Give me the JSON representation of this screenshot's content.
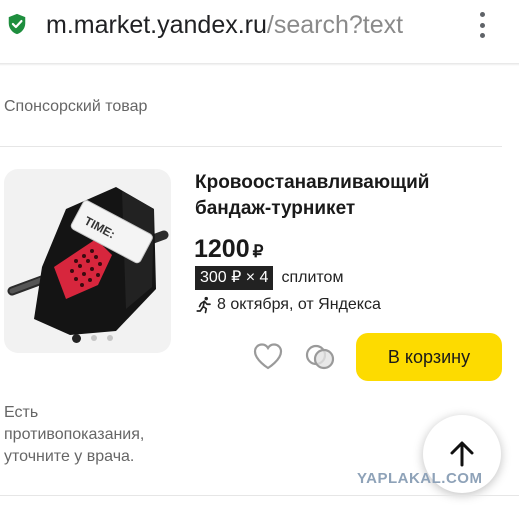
{
  "browser": {
    "url_host": "m.market.yandex.ru",
    "url_path": "/search?text",
    "secure_icon": "shield-check-icon",
    "menu_icon": "kebab-menu-icon"
  },
  "sponsor_label": "Спонсорский товар",
  "product": {
    "title": "Кровоостанавливающий бандаж-турникет",
    "price": "1200",
    "currency": "₽",
    "split_badge": "300 ₽ × 4",
    "split_text": "сплитом",
    "delivery": "8 октября, от Яндекса",
    "image_label": "TIME:",
    "image_pages": 3,
    "image_active_page": 1
  },
  "actions": {
    "cart_label": "В корзину",
    "favorite_icon": "heart-icon",
    "compare_icon": "compare-icon"
  },
  "warning": "Есть противопоказания, уточните у врача.",
  "scroll_top_icon": "arrow-up-icon",
  "watermark": "YAPLAKAL.COM",
  "colors": {
    "accent": "#fddb00",
    "secure": "#1e8e3e"
  }
}
